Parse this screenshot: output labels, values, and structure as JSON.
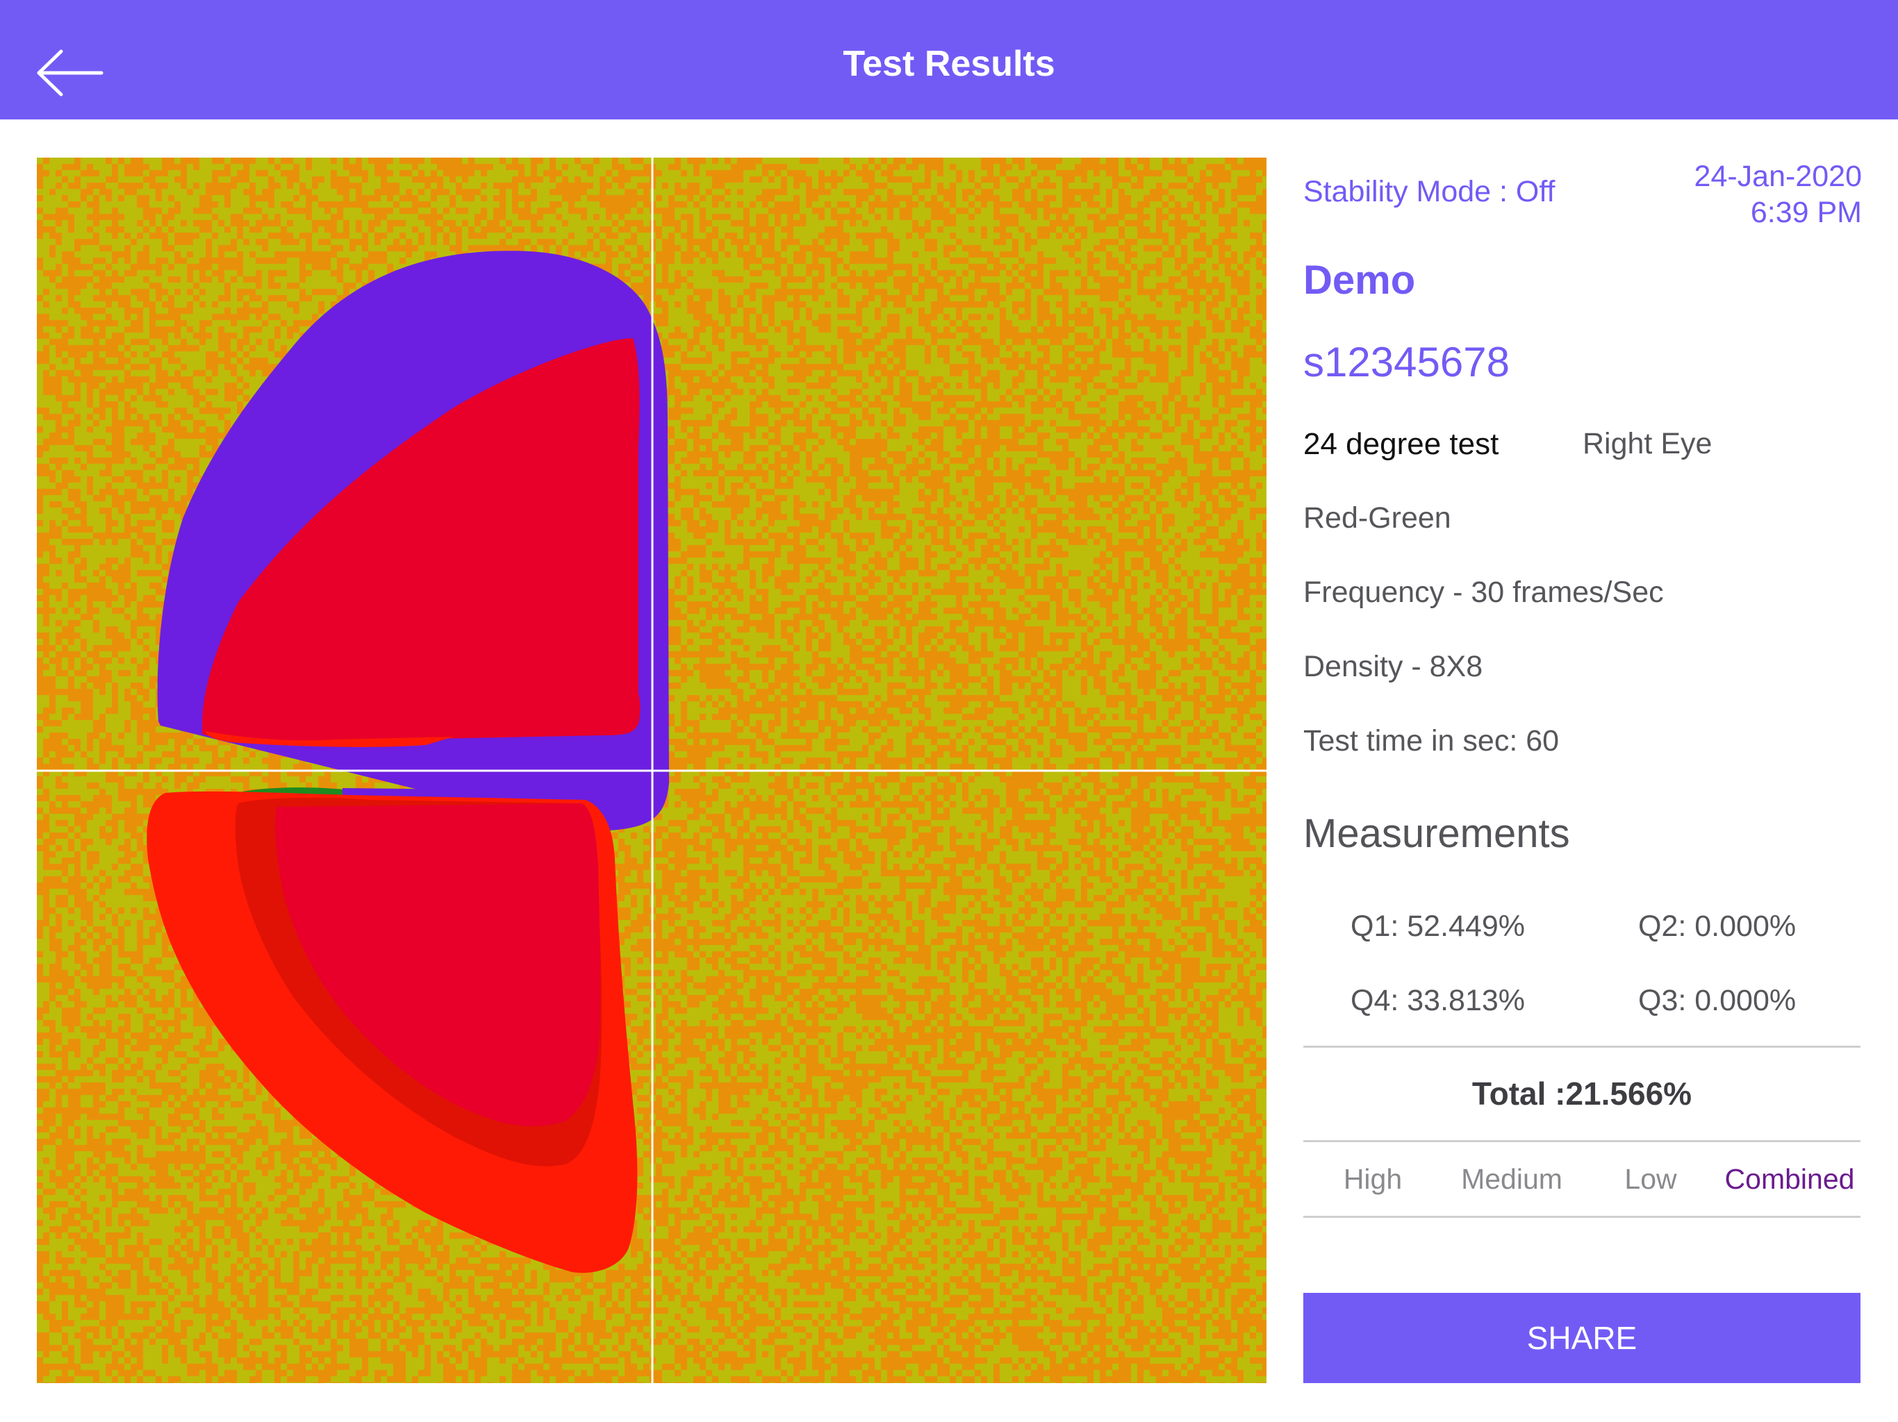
{
  "header": {
    "title": "Test Results"
  },
  "info": {
    "stability": "Stability Mode : Off",
    "date": "24-Jan-2020",
    "time": "6:39 PM",
    "name": "Demo",
    "subject_id": "s12345678",
    "test_type": "24 degree test",
    "eye": "Right Eye",
    "mode": "Red-Green",
    "frequency": "Frequency - 30 frames/Sec",
    "density": "Density - 8X8",
    "test_time": "Test time in sec: 60"
  },
  "measurements": {
    "title": "Measurements",
    "q1": "Q1: 52.449%",
    "q2": "Q2: 0.000%",
    "q3": "Q3: 0.000%",
    "q4": "Q4: 33.813%",
    "total": "Total :21.566%"
  },
  "segments": {
    "items": [
      "High",
      "Medium",
      "Low",
      "Combined"
    ],
    "selected": "Combined"
  },
  "share_label": "SHARE",
  "colors": {
    "accent": "#725bf5",
    "field_orange": "#e8900a",
    "field_yellow": "#bcbd0a",
    "region_purple": "#6c1fe0",
    "region_red": "#e8002a",
    "region_scarlet": "#ff1a05",
    "region_green": "#1f8a1f"
  }
}
